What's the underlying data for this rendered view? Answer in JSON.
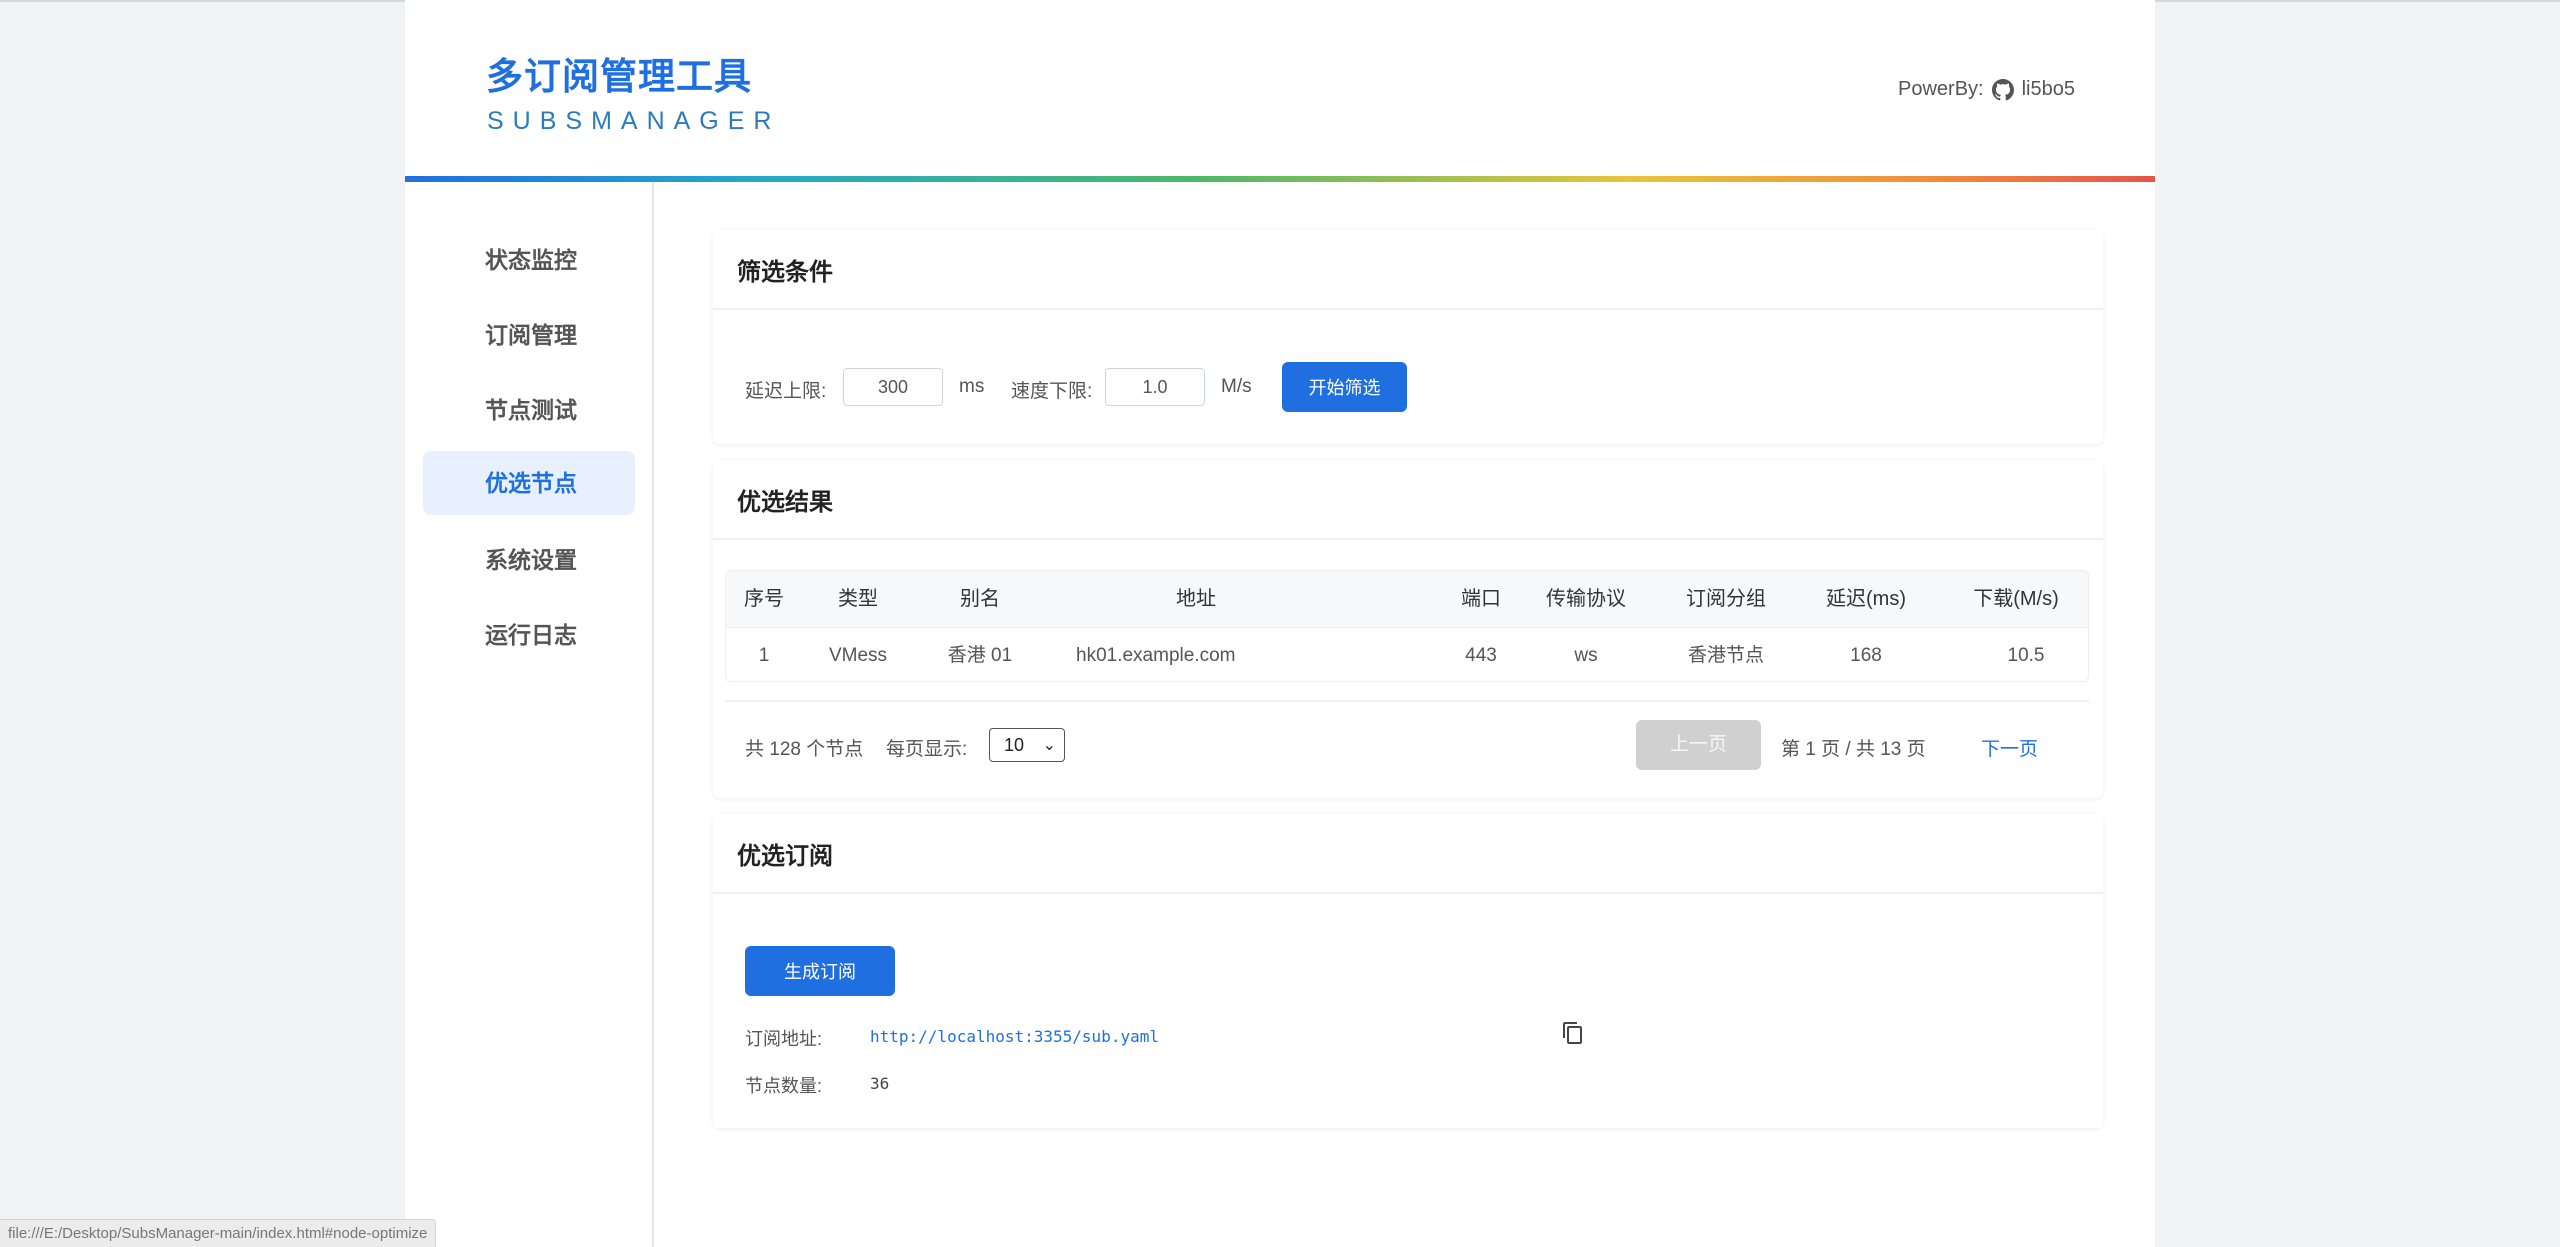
{
  "header": {
    "title": "多订阅管理工具",
    "subtitle": "SUBSMANAGER",
    "powerby_label": "PowerBy:",
    "github_icon": "github-icon",
    "author": "li5bo5"
  },
  "sidebar": {
    "items": [
      {
        "label": "状态监控"
      },
      {
        "label": "订阅管理"
      },
      {
        "label": "节点测试"
      },
      {
        "label": "优选节点"
      },
      {
        "label": "系统设置"
      },
      {
        "label": "运行日志"
      }
    ],
    "active_index": 3
  },
  "filter": {
    "title": "筛选条件",
    "latency_label": "延迟上限:",
    "latency_value": "300",
    "latency_unit": "ms",
    "speed_label": "速度下限:",
    "speed_value": "1.0",
    "speed_unit": "M/s",
    "start_button": "开始筛选"
  },
  "results": {
    "title": "优选结果",
    "columns": [
      "序号",
      "类型",
      "别名",
      "地址",
      "端口",
      "传输协议",
      "订阅分组",
      "延迟(ms)",
      "下载(M/s)"
    ],
    "rows": [
      [
        "1",
        "VMess",
        "香港 01",
        "hk01.example.com",
        "443",
        "ws",
        "香港节点",
        "168",
        "10.5"
      ]
    ],
    "total_text": "共 128 个节点",
    "per_page_label": "每页显示:",
    "per_page_value": "10",
    "prev_button": "上一页",
    "page_info": "第 1 页 / 共 13 页",
    "next_button": "下一页"
  },
  "subscription": {
    "title": "优选订阅",
    "generate_button": "生成订阅",
    "url_label": "订阅地址:",
    "url_value": "http://localhost:3355/sub.yaml",
    "copy_icon": "copy-icon",
    "count_label": "节点数量:",
    "count_value": "36"
  },
  "status_bar": {
    "url": "file:///E:/Desktop/SubsManager-main/index.html#node-optimize"
  },
  "colors": {
    "accent": "#1f6fe0",
    "active_nav_bg": "#e8f0fd",
    "page_bg": "#f2f3f6"
  }
}
